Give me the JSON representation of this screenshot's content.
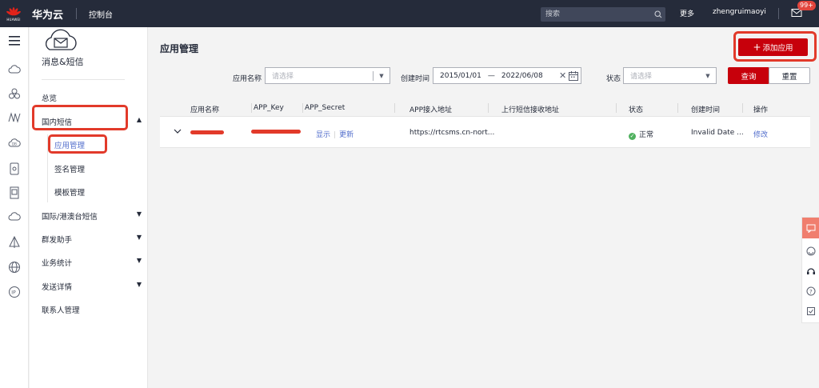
{
  "topbar": {
    "logo_text": "HUAWEI",
    "brand": "华为云",
    "console": "控制台",
    "search_placeholder": "搜索",
    "more": "更多",
    "username": "zhengruimaoyi",
    "badge": "99+"
  },
  "sidenav": {
    "service_title": "消息&短信",
    "items": [
      {
        "label": "总览"
      },
      {
        "label": "国内短信",
        "arrow": "▲"
      },
      {
        "label": "国际/港澳台短信",
        "arrow": "▼"
      },
      {
        "label": "群发助手",
        "arrow": "▼"
      },
      {
        "label": "业务统计",
        "arrow": "▼"
      },
      {
        "label": "发送详情",
        "arrow": "▼"
      },
      {
        "label": "联系人管理"
      }
    ],
    "sub_items": [
      {
        "label": "应用管理",
        "active": true
      },
      {
        "label": "签名管理"
      },
      {
        "label": "模板管理"
      }
    ]
  },
  "main": {
    "title": "应用管理",
    "add_button": "添加应用",
    "filters": {
      "app_name_label": "应用名称",
      "app_name_placeholder": "请选择",
      "created_label": "创建时间",
      "date_start": "2015/01/01",
      "date_sep": "—",
      "date_end": "2022/06/08",
      "status_label": "状态",
      "status_placeholder": "请选择",
      "query_button": "查询",
      "reset_button": "重置"
    },
    "table": {
      "columns": [
        "应用名称",
        "APP_Key",
        "APP_Secret",
        "APP接入地址",
        "上行短信接收地址",
        "状态",
        "创建时间",
        "操作"
      ],
      "rows": [
        {
          "app_name": "",
          "app_key": "",
          "secret_show": "显示",
          "secret_update": "更新",
          "address": "https://rtcsms.cn-nort...",
          "uplink": "",
          "status": "正常",
          "created": "Invalid Date ...",
          "action": "修改"
        }
      ]
    }
  },
  "colors": {
    "topbar_bg": "#252b3a",
    "brand_red": "#c7000b",
    "link_blue": "#526ecc",
    "status_green": "#50b15f",
    "highlight_red": "#e23a2a"
  }
}
